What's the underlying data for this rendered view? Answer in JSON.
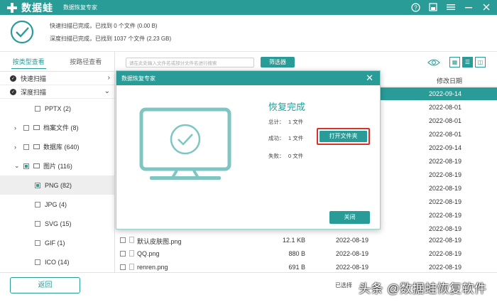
{
  "app": {
    "logo_text": "数据蛙",
    "subtitle": "数据恢复专家",
    "icons": [
      "help-icon",
      "save-icon",
      "menu-icon",
      "minimize-icon",
      "close-icon"
    ]
  },
  "status": {
    "quick_scan": "快速扫描已完成，已找到 0 个文件 (0.00 B)",
    "deep_scan": "深度扫描已完成，已找到 1037 个文件 (2.23 GB)"
  },
  "sidebar": {
    "tabs": [
      {
        "label": "按类型查看",
        "active": true
      },
      {
        "label": "按路径查看",
        "active": false
      }
    ],
    "scans": [
      {
        "label": "快速扫描"
      },
      {
        "label": "深度扫描"
      }
    ],
    "tree": [
      {
        "label": "PPTX (2)"
      },
      {
        "label": "档案文件 (8)"
      },
      {
        "label": "数据库 (640)"
      },
      {
        "label": "图片 (116)"
      },
      {
        "label": "PNG (82)"
      },
      {
        "label": "JPG (4)"
      },
      {
        "label": "SVG (15)"
      },
      {
        "label": "GIF (1)"
      },
      {
        "label": "ICO (14)"
      }
    ]
  },
  "toolbar": {
    "search_placeholder": "请在此处输入文件名或部分文件名进行搜索",
    "filter_label": "筛选器"
  },
  "list": {
    "header_modified": "修改日期",
    "modified_dates": [
      "2022-09-14",
      "2022-08-01",
      "2022-08-01",
      "2022-08-01",
      "2022-09-14",
      "2022-08-19",
      "2022-08-19",
      "2022-08-19",
      "2022-08-19",
      "2022-08-19",
      "2022-08-19"
    ],
    "files": [
      {
        "name": "默认皮肤图.png",
        "size": "12.1 KB",
        "date": "2022-08-19",
        "modified": "2022-08-19"
      },
      {
        "name": "QQ.png",
        "size": "880  B",
        "date": "2022-08-19",
        "modified": "2022-08-19"
      },
      {
        "name": "renren.png",
        "size": "691  B",
        "date": "2022-08-19",
        "modified": "2022-08-19"
      }
    ]
  },
  "dialog": {
    "title": "数据恢复专家",
    "heading": "恢复完成",
    "total_label": "总计：",
    "total_value": "1 文件",
    "success_label": "成功：",
    "success_value": "1 文件",
    "fail_label": "失败：",
    "fail_value": "0 文件",
    "open_folder": "打开文件夹",
    "close": "关闭"
  },
  "bottom": {
    "back": "返回",
    "selected_prefix": "已选择",
    "watermark": "头条 @数据蛙恢复软件"
  },
  "colors": {
    "accent": "#2a9c97",
    "highlight_border": "#d9302a"
  }
}
